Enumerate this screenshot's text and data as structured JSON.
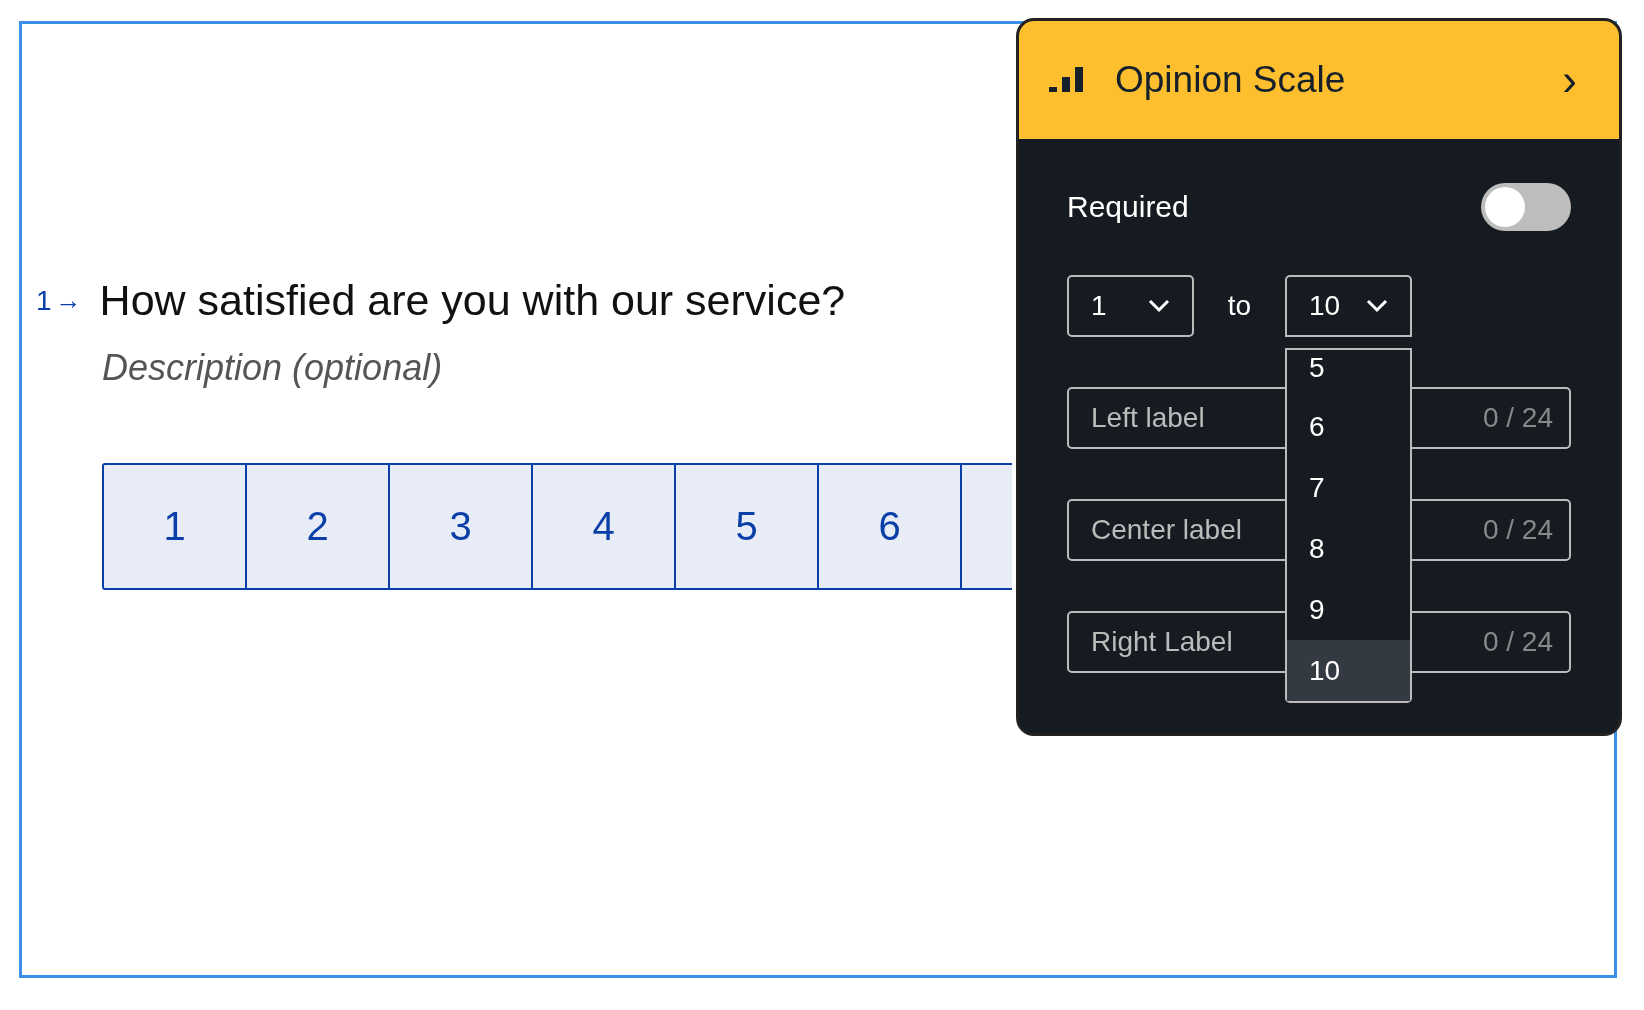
{
  "question": {
    "number": "1",
    "arrow": "→",
    "title": "How satisfied are you with our service?",
    "description_placeholder": "Description (optional)"
  },
  "scale": [
    "1",
    "2",
    "3",
    "4",
    "5",
    "6"
  ],
  "panel": {
    "title": "Opinion Scale",
    "chevron": "›",
    "required": {
      "label": "Required",
      "on": false
    },
    "range": {
      "from": "1",
      "separator": "to",
      "to": "10"
    },
    "to_options": [
      {
        "label": "5",
        "selected": false
      },
      {
        "label": "6",
        "selected": false
      },
      {
        "label": "7",
        "selected": false
      },
      {
        "label": "8",
        "selected": false
      },
      {
        "label": "9",
        "selected": false
      },
      {
        "label": "10",
        "selected": true
      }
    ],
    "label_fields": [
      {
        "placeholder": "Left label",
        "count": "0 / 24"
      },
      {
        "placeholder": "Center label",
        "count": "0 / 24"
      },
      {
        "placeholder": "Right Label",
        "count": "0 / 24"
      }
    ]
  }
}
